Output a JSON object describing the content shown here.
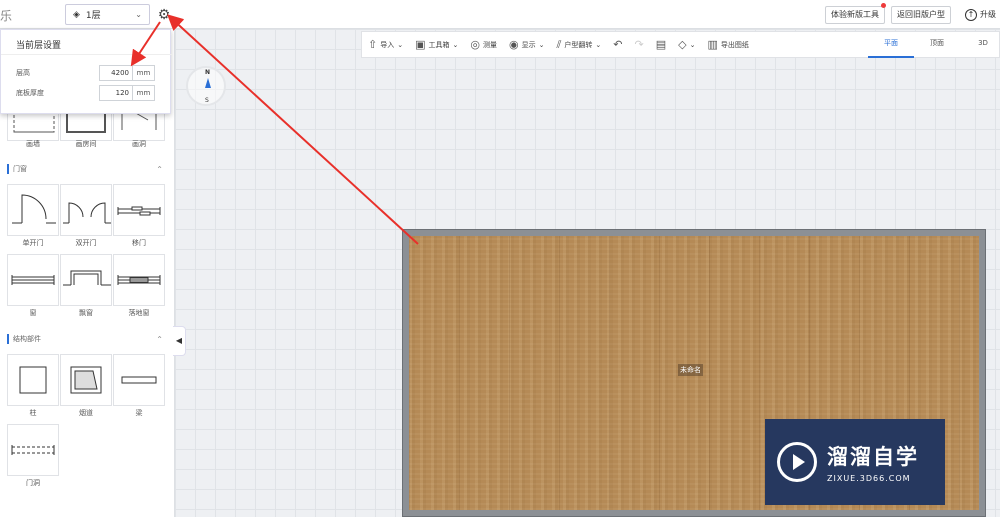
{
  "header": {
    "brand_fragment": "乐",
    "floor_label": "1层",
    "try_new_label": "体验新版工具",
    "back_old_label": "返回旧版户型",
    "upgrade_label": "升级"
  },
  "toolbar": {
    "items": [
      {
        "label": "导入",
        "icon": "import-icon"
      },
      {
        "label": "工具箱",
        "icon": "toolbox-icon"
      },
      {
        "label": "测量",
        "icon": "measure-icon"
      },
      {
        "label": "显示",
        "icon": "eye-icon"
      },
      {
        "label": "户型翻转",
        "icon": "flip-icon"
      },
      {
        "label": "导出图纸",
        "icon": "export-map-icon"
      }
    ],
    "view_tabs": [
      "平面",
      "顶面",
      "3D"
    ],
    "active_view": "平面"
  },
  "floor_settings": {
    "title": "当前层设置",
    "height_label": "层高",
    "height_value": "4200",
    "thickness_label": "底板厚度",
    "thickness_value": "120",
    "unit": "mm"
  },
  "sidebar": {
    "draw_items": [
      "画墙",
      "画房间",
      "画洞"
    ],
    "door_window_title": "门窗",
    "door_window_items": [
      "单开门",
      "双开门",
      "移门",
      "窗",
      "飘窗",
      "落地窗"
    ],
    "structure_title": "结构部件",
    "structure_items": [
      "柱",
      "烟道",
      "梁",
      "门洞"
    ]
  },
  "compass": {
    "north": "N",
    "south": "S"
  },
  "canvas": {
    "room_name": "未命名"
  },
  "watermark": {
    "cn": "溜溜自学",
    "en": "ZIXUE.3D66.COM"
  },
  "colors": {
    "accent": "#2a6fd6",
    "annotation_arrow": "#e8302a",
    "floor": "#b58a56",
    "watermark_bg": "#26385f"
  }
}
